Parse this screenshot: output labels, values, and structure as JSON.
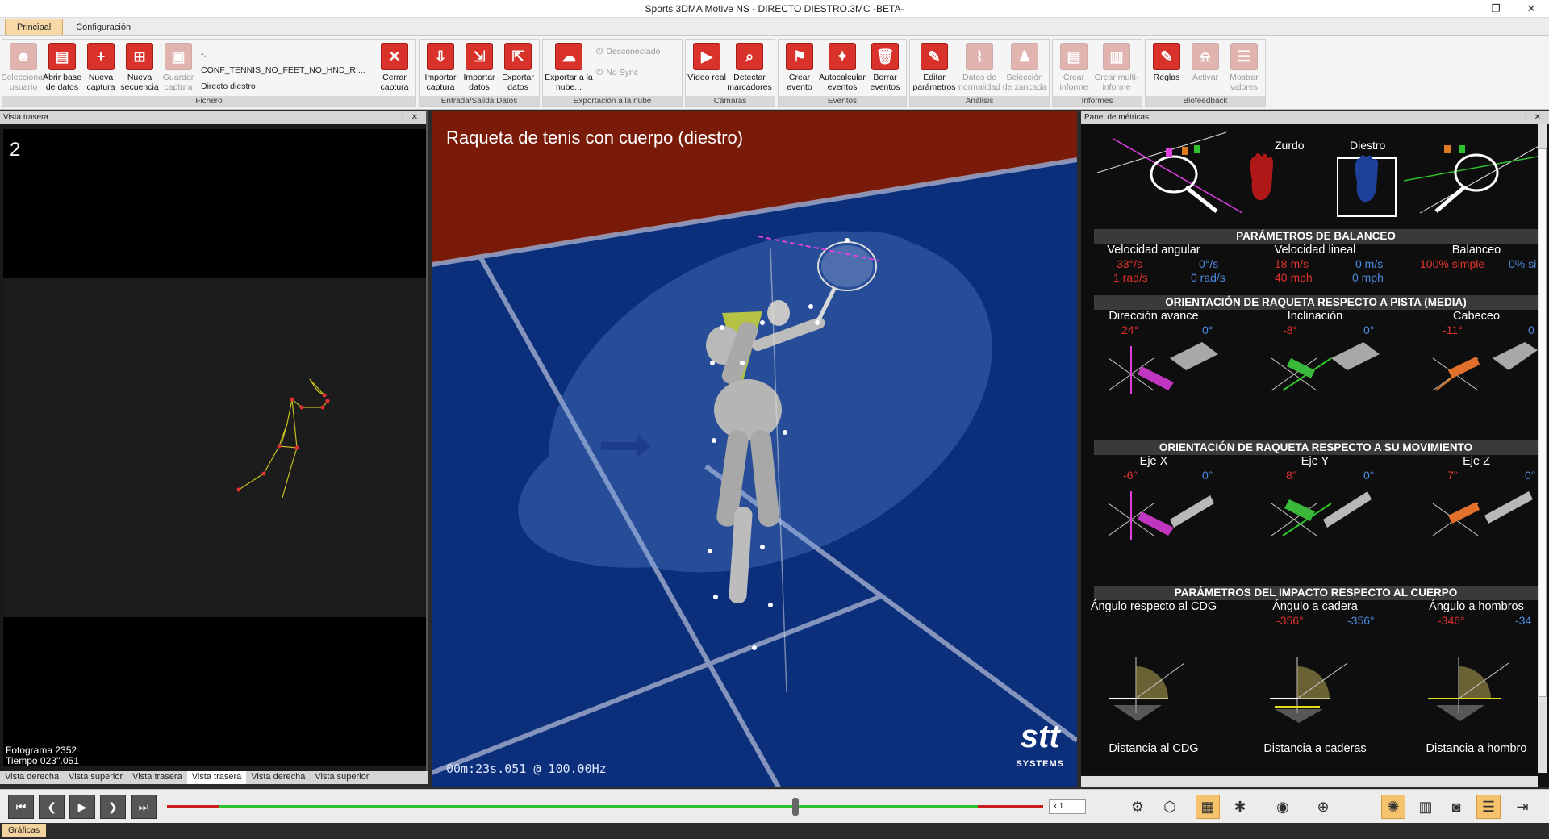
{
  "window": {
    "title": "Sports 3DMA Motive NS - DIRECTO DIESTRO.3MC -BETA-"
  },
  "ribbon_tabs": [
    "Principal",
    "Configuración"
  ],
  "ribbon": {
    "fichero": {
      "label": "Fichero",
      "buttons": [
        "Seleccionar usuario",
        "Abrir base de datos",
        "Nueva captura",
        "Nueva secuencia",
        "Guardar captura"
      ],
      "config_name": "-, CONF_TENNIS_NO_FEET_NO_HND_RI...",
      "capture_name": "Directo diestro",
      "close_button": "Cerrar captura"
    },
    "entrada": {
      "label": "Entrada/Salida Datos",
      "buttons": [
        "Importar captura",
        "Importar datos",
        "Exportar datos"
      ]
    },
    "nube": {
      "label": "Exportación a la nube",
      "button": "Exportar a la nube...",
      "status1": "Desconectado",
      "status2": "No Sync"
    },
    "camaras": {
      "label": "Cámaras",
      "buttons": [
        "Vídeo real",
        "Detectar marcadores"
      ]
    },
    "eventos": {
      "label": "Eventos",
      "buttons": [
        "Crear evento",
        "Autocalcular eventos",
        "Borrar eventos"
      ]
    },
    "analisis": {
      "label": "Análisis",
      "buttons": [
        "Editar parámetros",
        "Datos de normalidad",
        "Selección de zancada"
      ]
    },
    "informes": {
      "label": "Informes",
      "buttons": [
        "Crear informe",
        "Crear multi-informe"
      ]
    },
    "biofeedback": {
      "label": "Biofeedback",
      "buttons": [
        "Reglas",
        "Activar",
        "Mostrar valores"
      ]
    }
  },
  "left_panel": {
    "title": "Vista trasera",
    "frame_number": "2",
    "frame_label": "Fotograma 2352",
    "time_label": "Tiempo 023''.051",
    "tabs": [
      "Vista derecha",
      "Vista superior",
      "Vista trasera",
      "Vista trasera",
      "Vista derecha",
      "Vista superior"
    ]
  },
  "center_panel": {
    "title": "Raqueta de tenis con cuerpo (diestro)",
    "time": "00m:23s.051 @ 100.00Hz",
    "logo": "stt",
    "logo_sub": "SYSTEMS"
  },
  "right_panel": {
    "title": "Panel de métricas",
    "zurdo": "Zurdo",
    "diestro": "Diestro",
    "balanceo": {
      "title": "PARÁMETROS DE BALANCEO",
      "col1": "Velocidad angular",
      "col2": "Velocidad lineal",
      "col3": "Balanceo",
      "v1_red": "33°/s",
      "v1_blue": "0°/s",
      "v1b_red": "1 rad/s",
      "v1b_blue": "0 rad/s",
      "v2_red": "18 m/s",
      "v2_blue": "0 m/s",
      "v2b_red": "40 mph",
      "v2b_blue": "0 mph",
      "v3_red": "100% simple",
      "v3_blue": "0% si"
    },
    "pista": {
      "title": "ORIENTACIÓN DE RAQUETA RESPECTO A PISTA (MEDIA)",
      "col1": "Dirección avance",
      "col2": "Inclinación",
      "col3": "Cabeceo",
      "r1": "24°",
      "b1": "0°",
      "r2": "-8°",
      "b2": "0°",
      "r3": "-11°",
      "b3": "0"
    },
    "movimiento": {
      "title": "ORIENTACIÓN DE RAQUETA RESPECTO A SU MOVIMIENTO",
      "col1": "Eje X",
      "col2": "Eje Y",
      "col3": "Eje Z",
      "r1": "-6°",
      "b1": "0°",
      "r2": "8°",
      "b2": "0°",
      "r3": "7°",
      "b3": "0°"
    },
    "impacto": {
      "title": "PARÁMETROS DEL IMPACTO RESPECTO AL CUERPO",
      "col1": "Ángulo respecto al CDG",
      "col2": "Ángulo a cadera",
      "col3": "Ángulo a hombros",
      "r2": "-356°",
      "b2": "-356°",
      "r3": "-346°",
      "b3": "-34",
      "d1": "Distancia al CDG",
      "d2": "Distancia a caderas",
      "d3": "Distancia a hombro"
    }
  },
  "playback": {
    "speed": "x 1"
  },
  "status_tab": "Gráficas",
  "colors": {
    "accent": "#f6c26b",
    "red_value": "#e0322d",
    "blue_value": "#4f8be0",
    "court": "#0b2f7a"
  }
}
